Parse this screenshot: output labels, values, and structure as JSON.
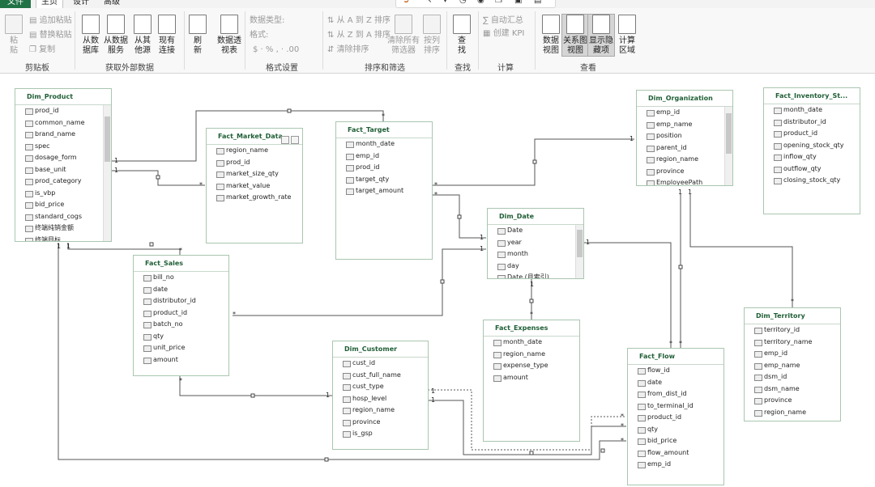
{
  "tabs": [
    "文件",
    "主页",
    "设计",
    "高级"
  ],
  "ribbon": {
    "clipboard": {
      "group": "剪贴板",
      "paste": "粘\n贴",
      "append_paste": "追加粘贴",
      "replace_paste": "替换粘贴",
      "copy": "复制"
    },
    "external": {
      "group": "获取外部数据",
      "from_db": "从数\n据库",
      "from_service": "从数据\n服务",
      "from_other": "从其\n他源",
      "existing": "现有\n连接"
    },
    "refresh": {
      "label": "刷\n新"
    },
    "pivot": {
      "label": "数据透\n视表"
    },
    "format": {
      "group": "格式设置",
      "data_type": "数据类型:",
      "format": "格式:",
      "symbols": "$ · % , ‧ .00"
    },
    "sort": {
      "group": "排序和筛选",
      "az": "从 A 到 Z 排序",
      "za": "从 Z 到 A 排序",
      "clear_sort": "清除排序",
      "clear_filters": "清除所有\n筛选器",
      "by_column": "按列\n排序"
    },
    "find": {
      "group": "查找",
      "label": "查\n找"
    },
    "calc": {
      "group": "计算",
      "autosum": "自动汇总",
      "kpi": "创建 KPI"
    },
    "view": {
      "group": "查看",
      "data_view": "数据\n视图",
      "diagram_view": "关系图\n视图",
      "show_hidden": "显示隐\n藏项",
      "calc_area": "计算\n区域"
    }
  },
  "tables": {
    "dim_product": {
      "name": "Dim_Product",
      "fields": [
        "prod_id",
        "common_name",
        "brand_name",
        "spec",
        "dosage_form",
        "base_unit",
        "prod_category",
        "is_vbp",
        "bid_price",
        "standard_cogs",
        "终端纯销金额",
        "终端目标"
      ]
    },
    "fact_market": {
      "name": "Fact_Market_Data",
      "fields": [
        "region_name",
        "prod_id",
        "market_size_qty",
        "market_value",
        "market_growth_rate"
      ]
    },
    "fact_target": {
      "name": "Fact_Target",
      "fields": [
        "month_date",
        "emp_id",
        "prod_id",
        "target_qty",
        "target_amount"
      ]
    },
    "dim_org": {
      "name": "Dim_Organization",
      "fields": [
        "emp_id",
        "emp_name",
        "position",
        "parent_id",
        "region_name",
        "province",
        "EmployeePath"
      ]
    },
    "fact_inventory": {
      "name": "Fact_Inventory_St...",
      "fields": [
        "month_date",
        "distributor_id",
        "product_id",
        "opening_stock_qty",
        "inflow_qty",
        "outflow_qty",
        "closing_stock_qty"
      ]
    },
    "dim_date": {
      "name": "Dim_Date",
      "fields": [
        "Date",
        "year",
        "month",
        "day",
        "Date (月索引)"
      ]
    },
    "fact_sales": {
      "name": "Fact_Sales",
      "fields": [
        "bill_no",
        "date",
        "distributor_id",
        "product_id",
        "batch_no",
        "qty",
        "unit_price",
        "amount"
      ]
    },
    "dim_customer": {
      "name": "Dim_Customer",
      "fields": [
        "cust_id",
        "cust_full_name",
        "cust_type",
        "hosp_level",
        "region_name",
        "province",
        "is_gsp"
      ]
    },
    "fact_expenses": {
      "name": "Fact_Expenses",
      "fields": [
        "month_date",
        "region_name",
        "expense_type",
        "amount"
      ]
    },
    "fact_flow": {
      "name": "Fact_Flow",
      "fields": [
        "flow_id",
        "date",
        "from_dist_id",
        "to_terminal_id",
        "product_id",
        "qty",
        "bid_price",
        "flow_amount",
        "emp_id"
      ]
    },
    "dim_territory": {
      "name": "Dim_Territory",
      "fields": [
        "territory_id",
        "territory_name",
        "emp_id",
        "emp_name",
        "dsm_id",
        "dsm_name",
        "province",
        "region_name"
      ]
    }
  },
  "cardinality": {
    "one": "1",
    "many": "*"
  }
}
